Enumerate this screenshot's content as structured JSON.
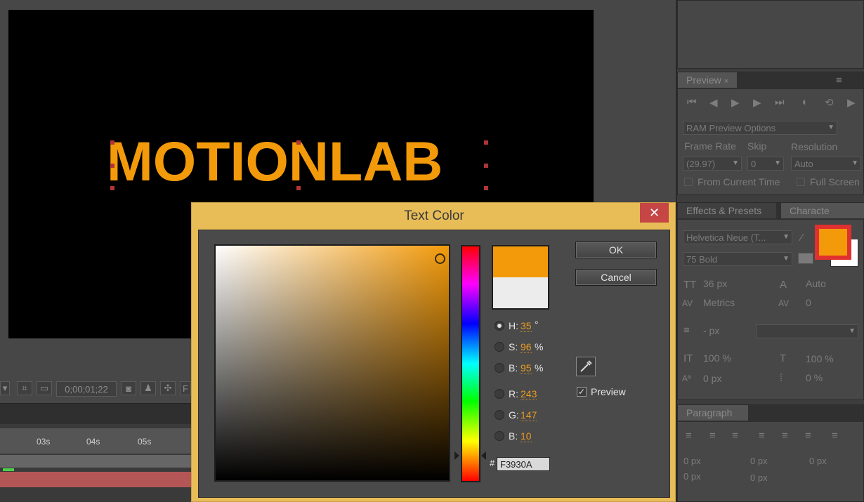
{
  "composition": {
    "text": "MOTIONLAB",
    "timecode": "0;00;01;22",
    "text_color": "#f39a0a"
  },
  "timeline": {
    "ticks": [
      "03s",
      "04s",
      "05s"
    ]
  },
  "preview_panel": {
    "tab": "Preview",
    "ram_preview_options": "RAM Preview Options",
    "frame_rate_label": "Frame Rate",
    "skip_label": "Skip",
    "resolution_label": "Resolution",
    "frame_rate_value": "(29.97)",
    "skip_value": "0",
    "resolution_value": "Auto",
    "from_current_time": "From Current Time",
    "full_screen": "Full Screen"
  },
  "character_panel": {
    "tab_effects": "Effects & Presets",
    "tab_character": "Characte",
    "font_family": "Helvetica Neue (T...",
    "font_style": "75 Bold",
    "font_size": "36 px",
    "leading": "Auto",
    "kerning": "Metrics",
    "tracking": "0",
    "stroke_width": "- px",
    "vertical_scale": "100 %",
    "horizontal_scale": "100 %",
    "baseline_shift": "0 px",
    "tsume": "0 %",
    "fill_color": "#f39a0a"
  },
  "paragraph_panel": {
    "tab": "Paragraph",
    "indent_left": "0 px",
    "indent_right": "0 px",
    "indent_first": "0 px",
    "space_before": "0 px",
    "space_after": "0 px"
  },
  "dialog": {
    "title": "Text Color",
    "close": "✕",
    "ok": "OK",
    "cancel": "Cancel",
    "preview": "Preview",
    "hex_prefix": "#",
    "hex": "F3930A",
    "new_color": "#f39a0a",
    "old_color": "#ececec",
    "fields": [
      {
        "label": "H:",
        "value": "35",
        "unit": "°",
        "selected": true
      },
      {
        "label": "S:",
        "value": "96",
        "unit": "%",
        "selected": false
      },
      {
        "label": "B:",
        "value": "95",
        "unit": "%",
        "selected": false
      },
      {
        "label": "R:",
        "value": "243",
        "unit": "",
        "selected": false
      },
      {
        "label": "G:",
        "value": "147",
        "unit": "",
        "selected": false
      },
      {
        "label": "B:",
        "value": "10",
        "unit": "",
        "selected": false
      }
    ]
  }
}
